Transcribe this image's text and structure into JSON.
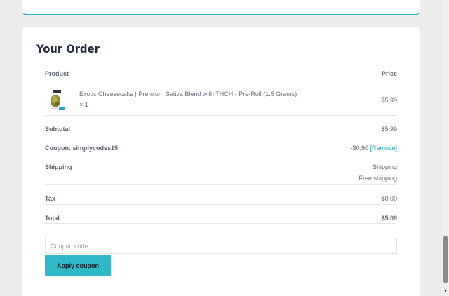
{
  "order": {
    "title": "Your Order",
    "header": {
      "product": "Product",
      "price": "Price"
    },
    "item": {
      "name": "Exotic Cheesecake | Premium Sativa Blend with THCH - Pre-Roll (1.5 Grams)",
      "qty": "× 1",
      "price": "$5.99",
      "thumbnail_icon": "pre-roll-product-image"
    },
    "subtotal": {
      "label": "Subtotal",
      "value": "$5.99"
    },
    "coupon": {
      "label": "Coupon: simplycodes15",
      "value": "-$0.90",
      "remove": "[Remove]"
    },
    "shipping": {
      "label": "Shipping",
      "value_line1": "Shipping",
      "value_line2": "Free shipping"
    },
    "tax": {
      "label": "Tax",
      "value": "$0.00"
    },
    "total": {
      "label": "Total",
      "value": "$5.09"
    }
  },
  "coupon_form": {
    "placeholder": "Coupon code",
    "apply_label": "Apply coupon"
  },
  "colors": {
    "accent": "#2fb8c6",
    "link": "#29a8c0",
    "title": "#1f2a3a",
    "background": "#ececec"
  }
}
